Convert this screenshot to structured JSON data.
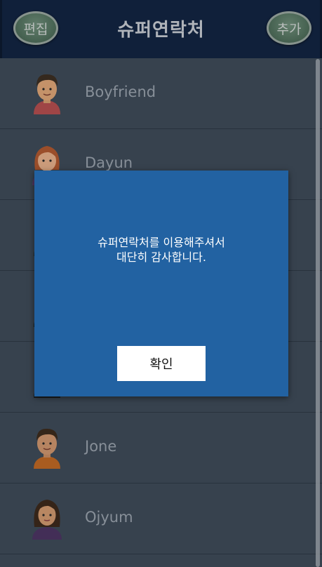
{
  "header": {
    "title": "슈퍼연락처",
    "edit_label": "편집",
    "add_label": "추가"
  },
  "contacts": [
    {
      "name": "Boyfriend",
      "avatar": "boy-avatar-icon"
    },
    {
      "name": "Dayun",
      "avatar": "girl-redhair-avatar-icon"
    },
    {
      "name": "",
      "avatar": "person-avatar-icon"
    },
    {
      "name": "",
      "avatar": "person-avatar-icon"
    },
    {
      "name": "",
      "avatar": "person-avatar-icon"
    },
    {
      "name": "Jone",
      "avatar": "boy-avatar-icon"
    },
    {
      "name": "Ojyum",
      "avatar": "girl-avatar-icon"
    }
  ],
  "dialog": {
    "message_line1": "슈퍼연락처를 이용해주셔서",
    "message_line2": "대단히 감사합니다.",
    "confirm_label": "확인"
  },
  "colors": {
    "header_bg": "#0f1f3c",
    "list_bg": "#3c4754",
    "dialog_bg": "#2262a2",
    "button_green": "#5a7a63"
  }
}
